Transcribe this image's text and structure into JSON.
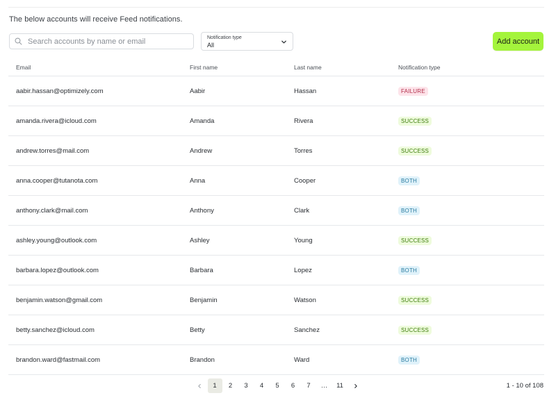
{
  "intro_text": "The below accounts will receive Feed notifications.",
  "search": {
    "placeholder": "Search accounts by name or email",
    "value": "",
    "icon": "search-icon"
  },
  "notification_filter": {
    "label": "Notification type",
    "value": "All",
    "icon": "chevron-down-icon"
  },
  "add_account_label": "Add account",
  "colors": {
    "accent": "#a4f43c",
    "failure_bg": "#fde4ea",
    "failure_text": "#b32e4a",
    "success_bg": "#eefbdc",
    "success_text": "#3e7d0c",
    "both_bg": "#e0f2fa",
    "both_text": "#2a7ca0"
  },
  "table": {
    "columns": [
      "Email",
      "First name",
      "Last name",
      "Notification type"
    ],
    "rows": [
      {
        "email": "aabir.hassan@optimizely.com",
        "first": "Aabir",
        "last": "Hassan",
        "type": "FAILURE"
      },
      {
        "email": "amanda.rivera@icloud.com",
        "first": "Amanda",
        "last": "Rivera",
        "type": "SUCCESS"
      },
      {
        "email": "andrew.torres@mail.com",
        "first": "Andrew",
        "last": "Torres",
        "type": "SUCCESS"
      },
      {
        "email": "anna.cooper@tutanota.com",
        "first": "Anna",
        "last": "Cooper",
        "type": "BOTH"
      },
      {
        "email": "anthony.clark@mail.com",
        "first": "Anthony",
        "last": "Clark",
        "type": "BOTH"
      },
      {
        "email": "ashley.young@outlook.com",
        "first": "Ashley",
        "last": "Young",
        "type": "SUCCESS"
      },
      {
        "email": "barbara.lopez@outlook.com",
        "first": "Barbara",
        "last": "Lopez",
        "type": "BOTH"
      },
      {
        "email": "benjamin.watson@gmail.com",
        "first": "Benjamin",
        "last": "Watson",
        "type": "SUCCESS"
      },
      {
        "email": "betty.sanchez@icloud.com",
        "first": "Betty",
        "last": "Sanchez",
        "type": "SUCCESS"
      },
      {
        "email": "brandon.ward@fastmail.com",
        "first": "Brandon",
        "last": "Ward",
        "type": "BOTH"
      }
    ]
  },
  "pagination": {
    "prev_icon": "chevron-left-icon",
    "next_icon": "chevron-right-icon",
    "pages": [
      "1",
      "2",
      "3",
      "4",
      "5",
      "6",
      "7",
      "…",
      "11"
    ],
    "current": "1",
    "range_text": "1 - 10 of 108"
  }
}
